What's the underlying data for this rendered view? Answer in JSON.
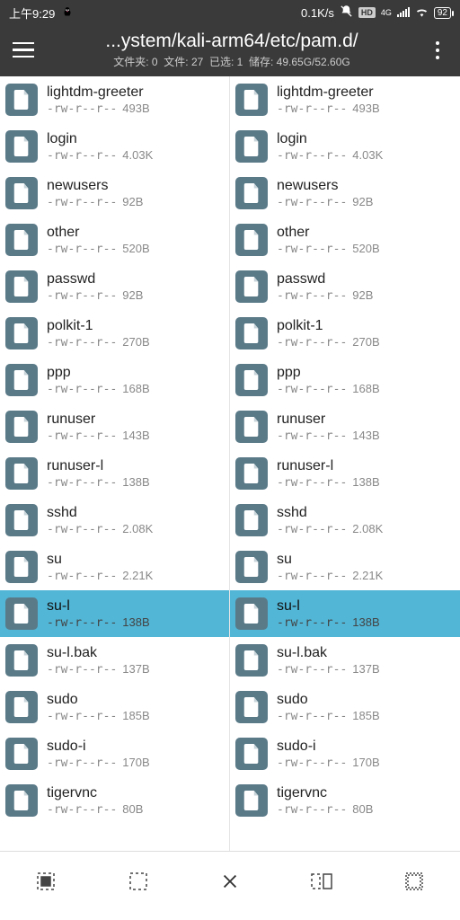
{
  "statusbar": {
    "time": "上午9:29",
    "net_speed": "0.1K/s",
    "hd": "HD",
    "signal": "4G",
    "battery": "92"
  },
  "header": {
    "path": "...ystem/kali-arm64/etc/pam.d/",
    "folders": "文件夹: 0",
    "files": "文件: 27",
    "selected": "已选: 1",
    "storage": "储存: 49.65G/52.60G"
  },
  "left": [
    {
      "n": "lightdm-greeter",
      "p": "-rw-r--r--",
      "s": "493B",
      "sel": false
    },
    {
      "n": "login",
      "p": "-rw-r--r--",
      "s": "4.03K",
      "sel": false
    },
    {
      "n": "newusers",
      "p": "-rw-r--r--",
      "s": "92B",
      "sel": false
    },
    {
      "n": "other",
      "p": "-rw-r--r--",
      "s": "520B",
      "sel": false
    },
    {
      "n": "passwd",
      "p": "-rw-r--r--",
      "s": "92B",
      "sel": false
    },
    {
      "n": "polkit-1",
      "p": "-rw-r--r--",
      "s": "270B",
      "sel": false
    },
    {
      "n": "ppp",
      "p": "-rw-r--r--",
      "s": "168B",
      "sel": false
    },
    {
      "n": "runuser",
      "p": "-rw-r--r--",
      "s": "143B",
      "sel": false
    },
    {
      "n": "runuser-l",
      "p": "-rw-r--r--",
      "s": "138B",
      "sel": false
    },
    {
      "n": "sshd",
      "p": "-rw-r--r--",
      "s": "2.08K",
      "sel": false
    },
    {
      "n": "su",
      "p": "-rw-r--r--",
      "s": "2.21K",
      "sel": false
    },
    {
      "n": "su-l",
      "p": "-rw-r--r--",
      "s": "138B",
      "sel": true
    },
    {
      "n": "su-l.bak",
      "p": "-rw-r--r--",
      "s": "137B",
      "sel": false
    },
    {
      "n": "sudo",
      "p": "-rw-r--r--",
      "s": "185B",
      "sel": false
    },
    {
      "n": "sudo-i",
      "p": "-rw-r--r--",
      "s": "170B",
      "sel": false
    },
    {
      "n": "tigervnc",
      "p": "-rw-r--r--",
      "s": "80B",
      "sel": false
    }
  ],
  "right": [
    {
      "n": "lightdm-greeter",
      "p": "-rw-r--r--",
      "s": "493B",
      "sel": false
    },
    {
      "n": "login",
      "p": "-rw-r--r--",
      "s": "4.03K",
      "sel": false
    },
    {
      "n": "newusers",
      "p": "-rw-r--r--",
      "s": "92B",
      "sel": false
    },
    {
      "n": "other",
      "p": "-rw-r--r--",
      "s": "520B",
      "sel": false
    },
    {
      "n": "passwd",
      "p": "-rw-r--r--",
      "s": "92B",
      "sel": false
    },
    {
      "n": "polkit-1",
      "p": "-rw-r--r--",
      "s": "270B",
      "sel": false
    },
    {
      "n": "ppp",
      "p": "-rw-r--r--",
      "s": "168B",
      "sel": false
    },
    {
      "n": "runuser",
      "p": "-rw-r--r--",
      "s": "143B",
      "sel": false
    },
    {
      "n": "runuser-l",
      "p": "-rw-r--r--",
      "s": "138B",
      "sel": false
    },
    {
      "n": "sshd",
      "p": "-rw-r--r--",
      "s": "2.08K",
      "sel": false
    },
    {
      "n": "su",
      "p": "-rw-r--r--",
      "s": "2.21K",
      "sel": false
    },
    {
      "n": "su-l",
      "p": "-rw-r--r--",
      "s": "138B",
      "sel": true
    },
    {
      "n": "su-l.bak",
      "p": "-rw-r--r--",
      "s": "137B",
      "sel": false
    },
    {
      "n": "sudo",
      "p": "-rw-r--r--",
      "s": "185B",
      "sel": false
    },
    {
      "n": "sudo-i",
      "p": "-rw-r--r--",
      "s": "170B",
      "sel": false
    },
    {
      "n": "tigervnc",
      "p": "-rw-r--r--",
      "s": "80B",
      "sel": false
    }
  ]
}
